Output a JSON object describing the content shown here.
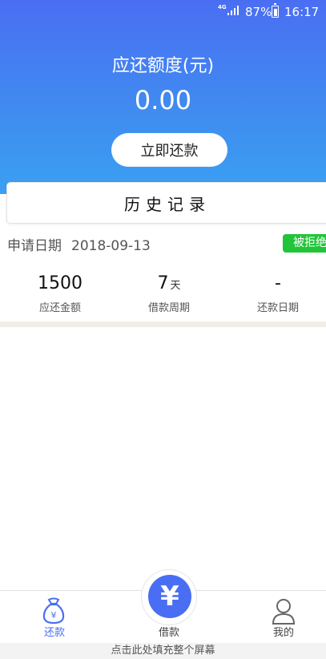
{
  "status_bar": {
    "network": "4G",
    "battery": "87%",
    "time": "16:17"
  },
  "header": {
    "title": "应还额度(元)",
    "amount": "0.00",
    "repay_button": "立即还款"
  },
  "history": {
    "title": "历史记录"
  },
  "record": {
    "apply_label": "申请日期",
    "apply_date": "2018-09-13",
    "status": "被拒绝",
    "amount_value": "1500",
    "amount_label": "应还金额",
    "period_value": "7",
    "period_unit": "天",
    "period_label": "借款周期",
    "due_value": "-",
    "due_label": "还款日期"
  },
  "tabbar": {
    "repay": "还款",
    "loan": "借款",
    "mine": "我的",
    "loan_icon_glyph": "¥",
    "repay_icon_glyph": "¥"
  },
  "fill_hint": "点击此处填充整个屏幕",
  "colors": {
    "accent": "#4a6ef3",
    "status_green": "#22c43a"
  }
}
